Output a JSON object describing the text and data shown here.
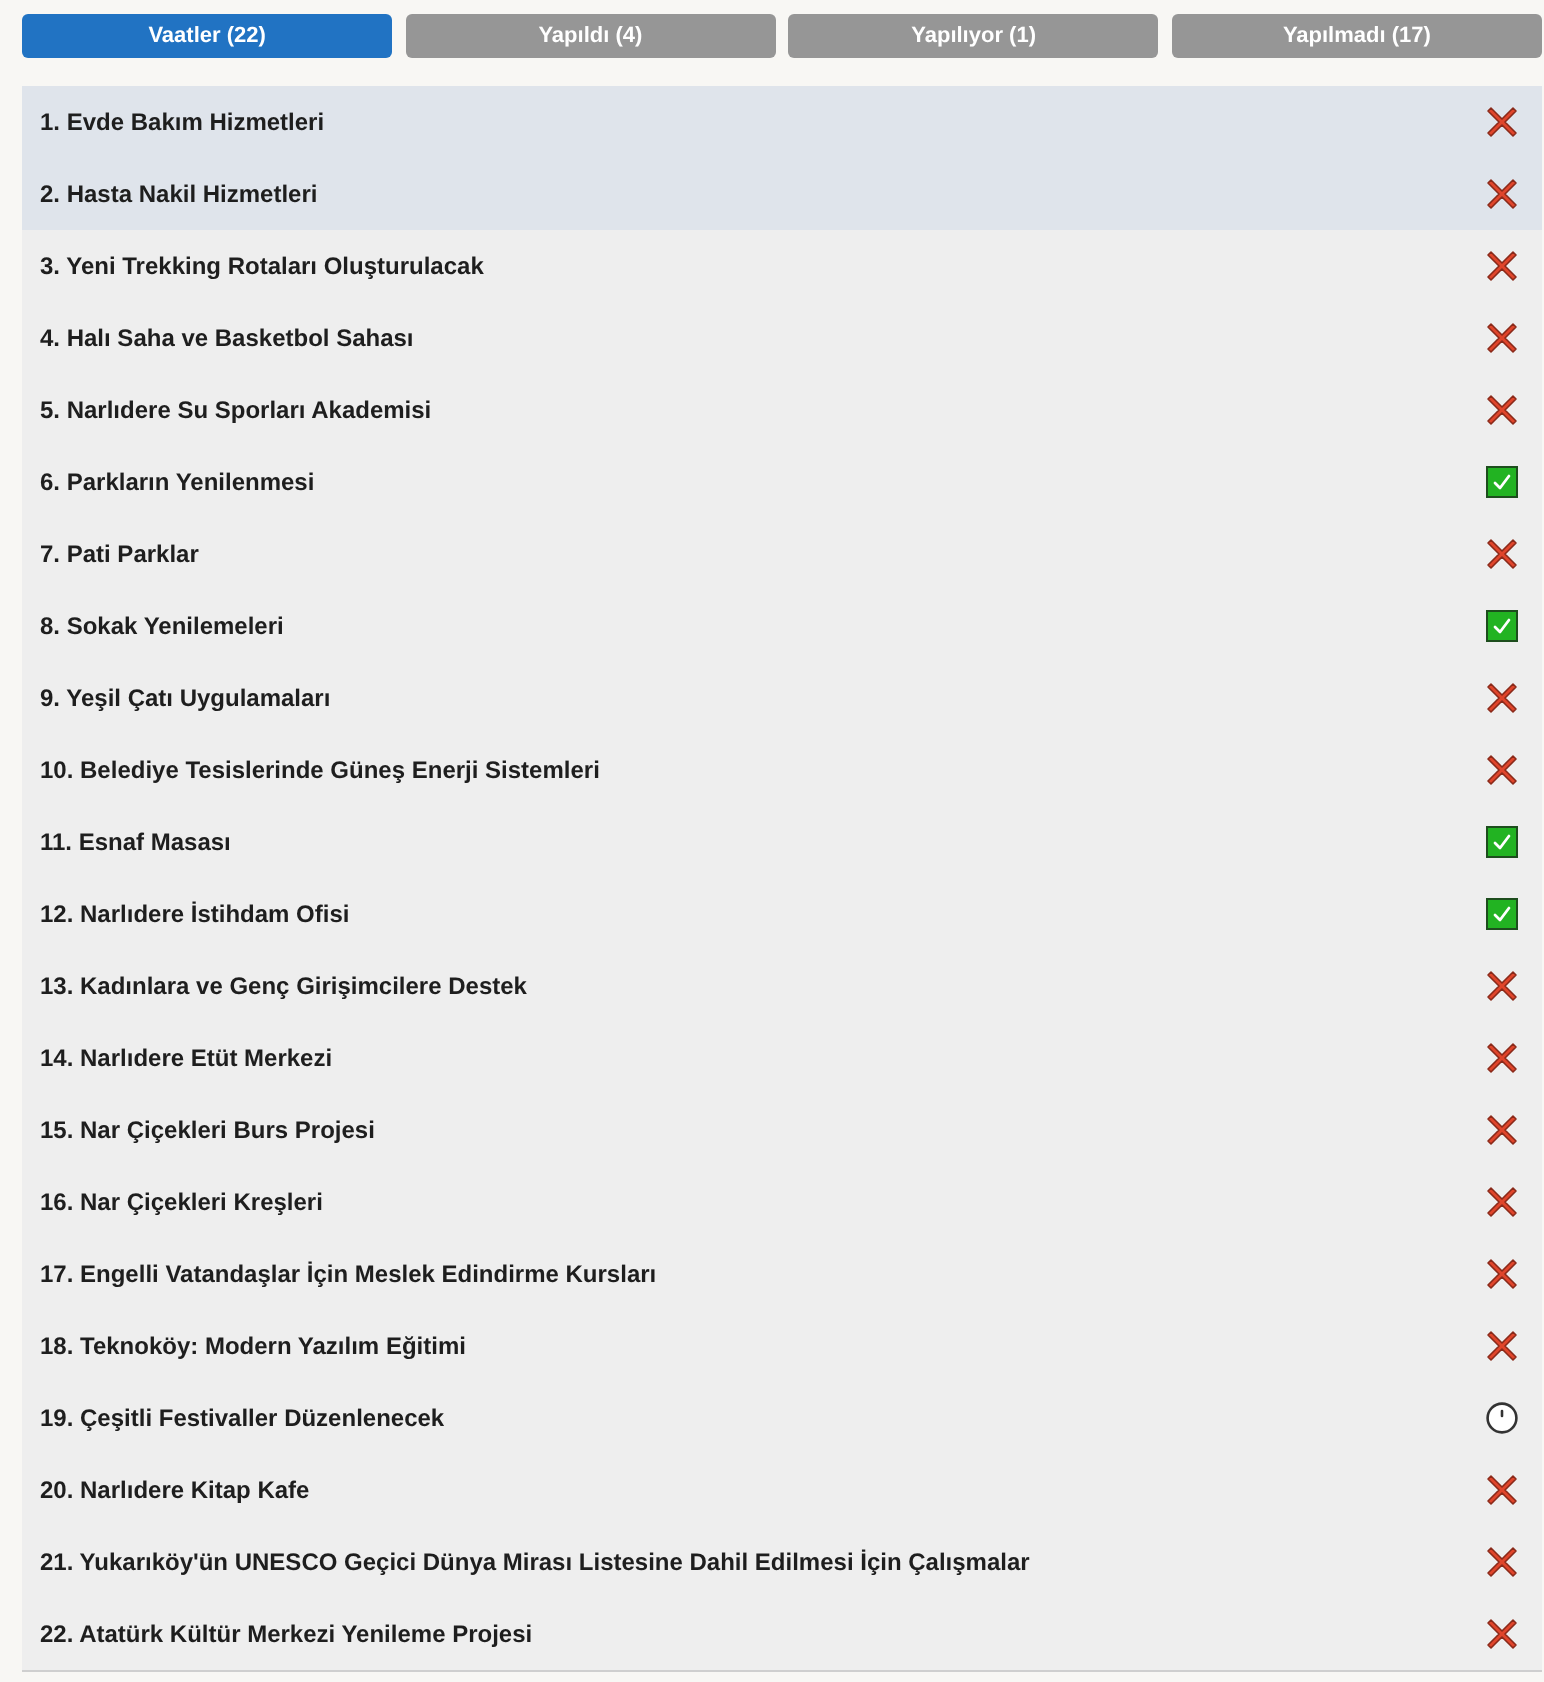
{
  "tabs": [
    {
      "label": "Vaatler (22)",
      "selected": true
    },
    {
      "label": "Yapıldı (4)",
      "selected": false
    },
    {
      "label": "Yapılıyor (1)",
      "selected": false
    },
    {
      "label": "Yapılmadı (17)",
      "selected": false
    }
  ],
  "items": [
    {
      "title": "1. Evde Bakım Hizmetleri",
      "kind": "undone",
      "highlighted": true
    },
    {
      "title": "2. Hasta Nakil Hizmetleri",
      "kind": "undone",
      "highlighted": true
    },
    {
      "title": "3. Yeni Trekking Rotaları Oluşturulacak",
      "kind": "undone",
      "highlighted": false
    },
    {
      "title": "4. Halı Saha ve Basketbol Sahası",
      "kind": "undone",
      "highlighted": false
    },
    {
      "title": "5. Narlıdere Su Sporları Akademisi",
      "kind": "undone",
      "highlighted": false
    },
    {
      "title": "6. Parkların Yenilenmesi",
      "kind": "done",
      "highlighted": false
    },
    {
      "title": "7. Pati Parklar",
      "kind": "undone",
      "highlighted": false
    },
    {
      "title": "8. Sokak Yenilemeleri",
      "kind": "done",
      "highlighted": false
    },
    {
      "title": "9. Yeşil Çatı Uygulamaları",
      "kind": "undone",
      "highlighted": false
    },
    {
      "title": "10. Belediye Tesislerinde Güneş Enerji Sistemleri",
      "kind": "undone",
      "highlighted": false
    },
    {
      "title": "11. Esnaf Masası",
      "kind": "done",
      "highlighted": false
    },
    {
      "title": "12. Narlıdere İstihdam Ofisi",
      "kind": "done",
      "highlighted": false
    },
    {
      "title": "13. Kadınlara ve Genç Girişimcilere Destek",
      "kind": "undone",
      "highlighted": false
    },
    {
      "title": "14. Narlıdere Etüt Merkezi",
      "kind": "undone",
      "highlighted": false
    },
    {
      "title": "15. Nar Çiçekleri Burs Projesi",
      "kind": "undone",
      "highlighted": false
    },
    {
      "title": "16. Nar Çiçekleri Kreşleri",
      "kind": "undone",
      "highlighted": false
    },
    {
      "title": "17. Engelli Vatandaşlar İçin Meslek Edindirme Kursları",
      "kind": "undone",
      "highlighted": false
    },
    {
      "title": "18. Teknoköy: Modern Yazılım Eğitimi",
      "kind": "undone",
      "highlighted": false
    },
    {
      "title": "19. Çeşitli Festivaller Düzenlenecek",
      "kind": "ongoing",
      "highlighted": false
    },
    {
      "title": "20. Narlıdere Kitap Kafe",
      "kind": "undone",
      "highlighted": false
    },
    {
      "title": "21. Yukarıköy'ün UNESCO Geçici Dünya Mirası Listesine Dahil Edilmesi İçin Çalışmalar",
      "kind": "undone",
      "highlighted": false
    },
    {
      "title": "22. Atatürk Kültür Merkezi Yenileme Projesi",
      "kind": "undone",
      "highlighted": false
    }
  ]
}
